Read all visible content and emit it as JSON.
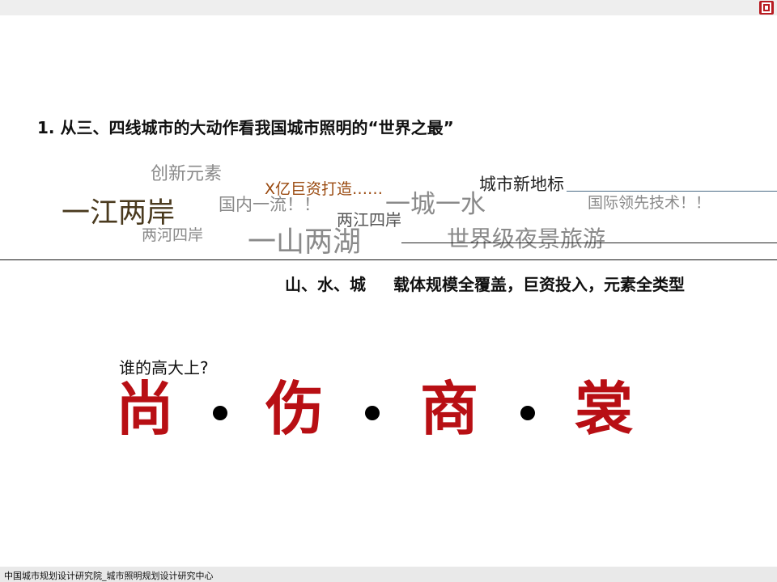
{
  "colors": {
    "accent_red": "#b81c22",
    "title_red": "#b80f14",
    "keyword_gray": "#8a8a8a",
    "keyword_dark": "#555555",
    "keyword_brown": "#4a3a1e",
    "keyword_orange": "#9a4a10"
  },
  "header": {
    "logo": "logo-mark"
  },
  "heading": "1.  从三、四线城市的大动作看我国城市照明的“世界之最”",
  "keywords": [
    "创新元素",
    "X亿巨资打造……",
    "城市新地标",
    "一江两岸",
    "国内一流！！",
    "一城一水",
    "国际领先技术！！",
    "两河四岸",
    "两江四岸",
    "一山两湖",
    "世界级夜景旅游"
  ],
  "subtitle": {
    "left": "山、水、城",
    "right": "载体规模全覆盖，巨资投入，元素全类型"
  },
  "question": "谁的高大上?",
  "big_title": [
    "尚",
    "伤",
    "商",
    "裳"
  ],
  "footer": {
    "text": "中国城市规划设计研究院_城市照明规划设计研究中心"
  }
}
